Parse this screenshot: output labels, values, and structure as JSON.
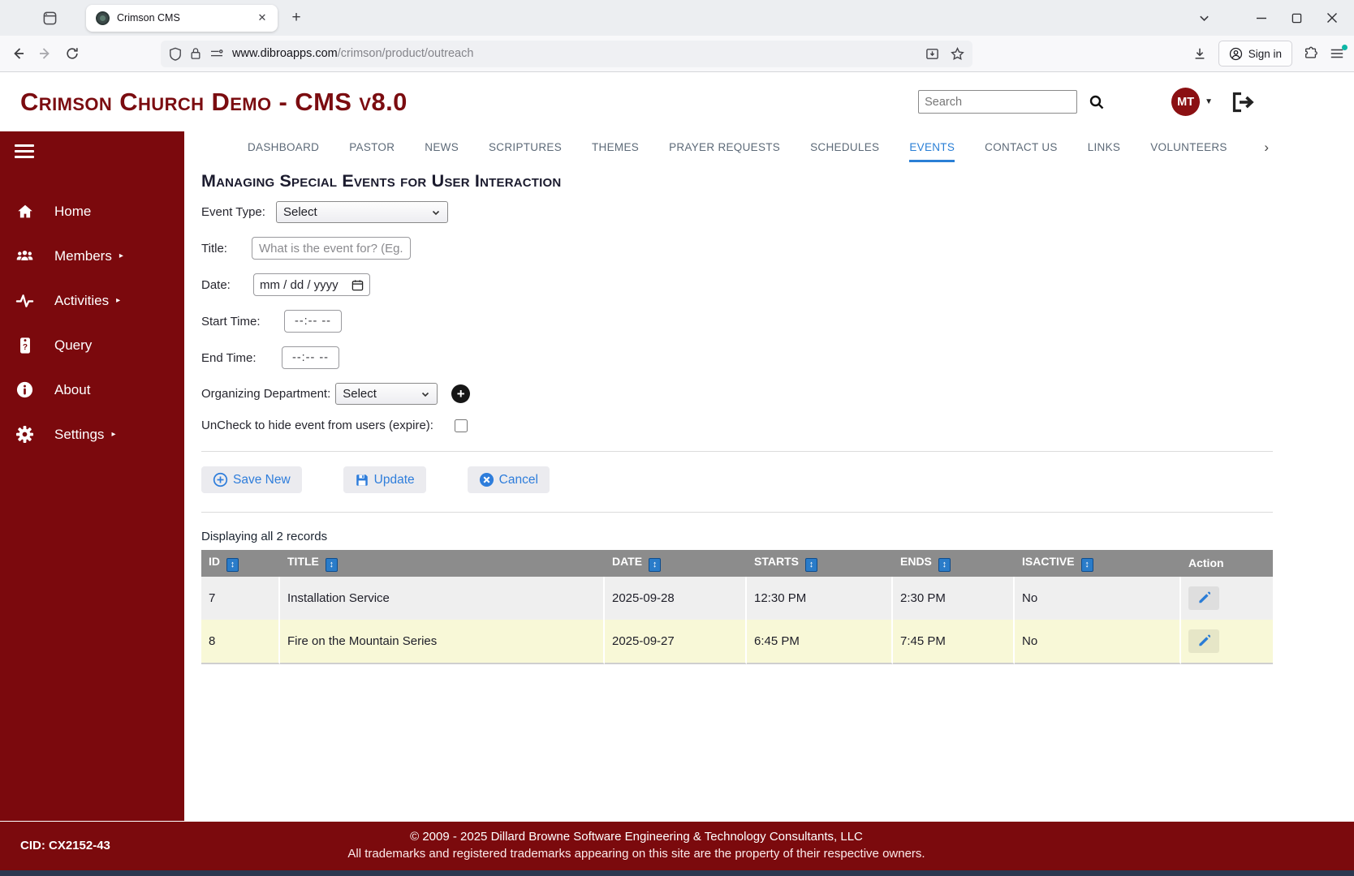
{
  "browser": {
    "tab_title": "Crimson CMS",
    "url_host": "www.dibroapps.com",
    "url_path": "/crimson/product/outreach",
    "sign_in_label": "Sign in"
  },
  "header": {
    "title": "Crimson Church Demo - CMS v8.0",
    "search_placeholder": "Search",
    "avatar_initials": "MT"
  },
  "sidebar": {
    "items": [
      {
        "label": "Home",
        "caret": ""
      },
      {
        "label": "Members",
        "caret": "▸"
      },
      {
        "label": "Activities",
        "caret": "▸"
      },
      {
        "label": "Query",
        "caret": ""
      },
      {
        "label": "About",
        "caret": ""
      },
      {
        "label": "Settings",
        "caret": "▸"
      }
    ]
  },
  "nav": {
    "items": [
      "DASHBOARD",
      "PASTOR",
      "NEWS",
      "SCRIPTURES",
      "THEMES",
      "PRAYER REQUESTS",
      "SCHEDULES",
      "EVENTS",
      "CONTACT US",
      "LINKS",
      "VOLUNTEERS"
    ],
    "overflow_chevron": "›"
  },
  "main": {
    "heading": "Managing Special Events for User Interaction",
    "form": {
      "event_type_label": "Event Type:",
      "event_type_value": "Select",
      "title_label": "Title:",
      "title_placeholder": "What is the event for? (Eg.",
      "date_label": "Date:",
      "date_value": "mm / dd / yyyy",
      "start_time_label": "Start Time:",
      "start_time_value": "--:--  --",
      "end_time_label": "End Time:",
      "end_time_value": "--:--  --",
      "org_dept_label": "Organizing Department:",
      "org_dept_value": "Select",
      "expire_label": "UnCheck to hide event from users (expire):"
    },
    "buttons": {
      "save_new": "Save New",
      "update": "Update",
      "cancel": "Cancel"
    },
    "table": {
      "summary": "Displaying all 2 records",
      "sort_glyph": "↕",
      "columns": [
        "ID",
        "TITLE",
        "DATE",
        "STARTS",
        "ENDS",
        "ISACTIVE",
        "Action"
      ],
      "rows": [
        {
          "id": "7",
          "title": "Installation Service",
          "date": "2025-09-28",
          "starts": "12:30 PM",
          "ends": "2:30 PM",
          "isactive": "No"
        },
        {
          "id": "8",
          "title": "Fire on the Mountain Series",
          "date": "2025-09-27",
          "starts": "6:45 PM",
          "ends": "7:45 PM",
          "isactive": "No"
        }
      ]
    }
  },
  "footer": {
    "cid": "CID: CX2152-43",
    "line1": "© 2009 - 2025 Dillard Browne Software Engineering & Technology Consultants, LLC",
    "line2": "All trademarks and registered trademarks appearing on this site are the property of their respective owners."
  },
  "colors": {
    "maroon": "#7b090d",
    "title_maroon": "#7b0c10",
    "nav_active_blue": "#2a7fd6",
    "table_header_gray": "#8c8c8c",
    "row_alt_yellow": "#f8f8d7",
    "sort_icon_blue": "#2a7cc9",
    "bottom_strip_navy": "#2b3850"
  }
}
